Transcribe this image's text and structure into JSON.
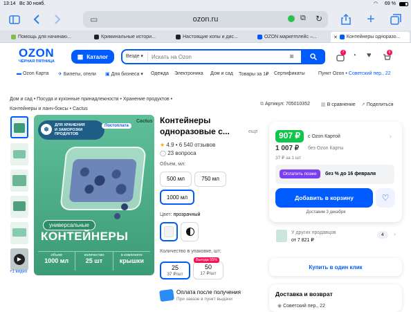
{
  "status": {
    "time": "13:14",
    "date": "Вс 30 нояб.",
    "battery": "69 %"
  },
  "browser": {
    "url": "ozon.ru",
    "sidebar_icon": "sidebar-icon",
    "back_icon": "chevron-left-icon",
    "forward_icon": "chevron-right-icon"
  },
  "tabs": [
    {
      "label": "Помощь для начинаю...",
      "color": "#7bbf4a"
    },
    {
      "label": "Криминальные истори...",
      "color": "#222222"
    },
    {
      "label": "Настоящие копы и дис...",
      "color": "#222222"
    },
    {
      "label": "OZON маркетплейс –...",
      "color": "#005bff"
    },
    {
      "label": "Контейнеры одноразо...",
      "color": "#005bff"
    }
  ],
  "header": {
    "logo": "OZON",
    "logo_sub": "ЧЁРНАЯ ПЯТНИЦА",
    "catalog": "Каталог",
    "search_scope": "Везде",
    "search_placeholder": "Искать на Ozon",
    "badges": {
      "orders": "7",
      "cart": "6"
    }
  },
  "nav": [
    "Ozon Карта",
    "Билеты, отели",
    "Для бизнеса",
    "Одежда",
    "Электроника",
    "Дом и сад",
    "Товары за 1₽",
    "Сертификаты"
  ],
  "pickup": {
    "label": "Пункт Ozon",
    "address": "Советский пер., 22"
  },
  "breadcrumb": {
    "line1": [
      "Дом и сад",
      "Посуда и кухонные принадлежности",
      "Хранение продуктов"
    ],
    "line2": [
      "Контейнеры и ланч-боксы",
      "Cactus"
    ]
  },
  "meta": {
    "article": "Артикул: 705010352",
    "compare": "В сравнение",
    "share": "Поделиться"
  },
  "product": {
    "title_line1": "Контейнеры",
    "title_line2": "одноразовые с...",
    "more": "ещё",
    "rating": "4.9 • 6 540 отзывов",
    "questions": "23 вопроса",
    "image": {
      "badge_line1": "ДЛЯ ХРАНЕНИЯ",
      "badge_line2": "И ЗАМОРОЗКИ",
      "badge_line3": "ПРОДУКТОВ",
      "brand": "Cactus",
      "postoplata": "Постоплата",
      "pill": "универсальные",
      "headline": "КОНТЕЙНЕРЫ",
      "spec1_label": "объем",
      "spec1_value": "1000 мл",
      "spec2_label": "количество",
      "spec2_value": "25 шт",
      "spec3_label": "в комплекте",
      "spec3_value": "крышки"
    },
    "video_label": "+1 видео",
    "volume_label": "Объем, мл:",
    "volumes": [
      "500 мл",
      "750 мл",
      "1000 мл"
    ],
    "selected_volume": "1000 мл",
    "color_label": "Цвет:",
    "color_value": "прозрачный",
    "qty_label": "Количество в упаковке, шт:",
    "qty_options": [
      {
        "qty": "25",
        "price": "37 ₽/шт"
      },
      {
        "qty": "50",
        "price": "17 ₽/шт",
        "promo": "Выгода 55%"
      }
    ],
    "pay_later_title": "Оплата после получения",
    "pay_later_sub": "При заказе в пункт выдачи"
  },
  "price": {
    "card_price": "907 ₽",
    "card_label": "с Ozon Картой",
    "regular": "1 007 ₽",
    "regular_label": "без Ozon Карты",
    "per_unit": "37 ₽ за 1 шт",
    "pay_later_btn": "Оплатить позже",
    "pay_later_text": "без % до 16 февраля",
    "add_to_cart": "Добавить в корзину",
    "delivery": "Доставим 3 декабря"
  },
  "sellers": {
    "label": "У других продавцов",
    "price": "от 7 821 ₽",
    "count": "4"
  },
  "one_click": "Купить в один клик",
  "delivery_section": {
    "title": "Доставка и возврат",
    "address": "Советский пер., 22"
  }
}
